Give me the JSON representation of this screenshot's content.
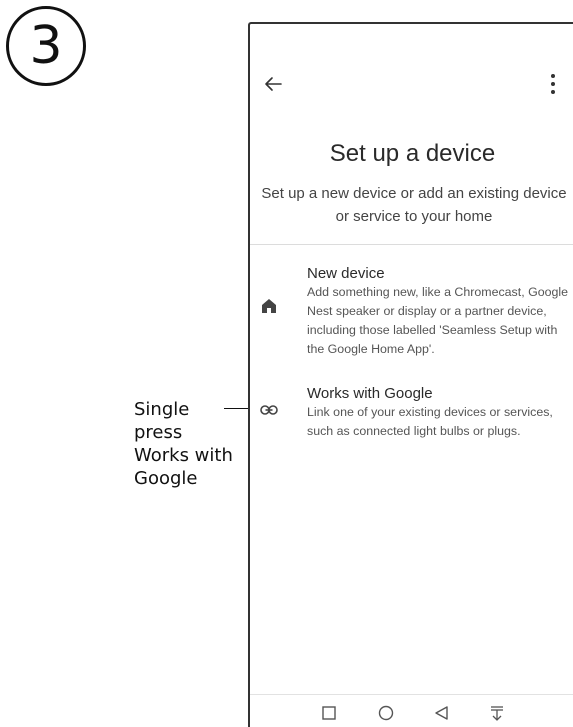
{
  "step": {
    "number": "3"
  },
  "annotation": {
    "text_lines": [
      "Single",
      "press",
      "Works with",
      "Google"
    ]
  },
  "screen": {
    "title": "Set up a device",
    "subtitle": "Set up a new device or add an existing device or service to your home",
    "items": [
      {
        "icon": "home-icon",
        "title": "New device",
        "description": "Add something new, like a Chromecast, Google Nest speaker or display or a partner device, including those labelled 'Seamless Setup with the Google Home App'."
      },
      {
        "icon": "link-icon",
        "title": "Works with Google",
        "description": "Link one of your existing devices or services, such as connected light bulbs or plugs."
      }
    ],
    "topbar": {
      "back_icon": "back-arrow-icon",
      "menu_icon": "more-vert-icon"
    },
    "navbar": {
      "buttons": [
        "recent-apps-icon",
        "home-circle-icon",
        "back-triangle-icon",
        "notifications-down-icon"
      ]
    }
  },
  "colors": {
    "text_primary": "#2a2a2a",
    "text_secondary": "#555555",
    "icon": "#444444",
    "divider": "#dcdcdc"
  }
}
